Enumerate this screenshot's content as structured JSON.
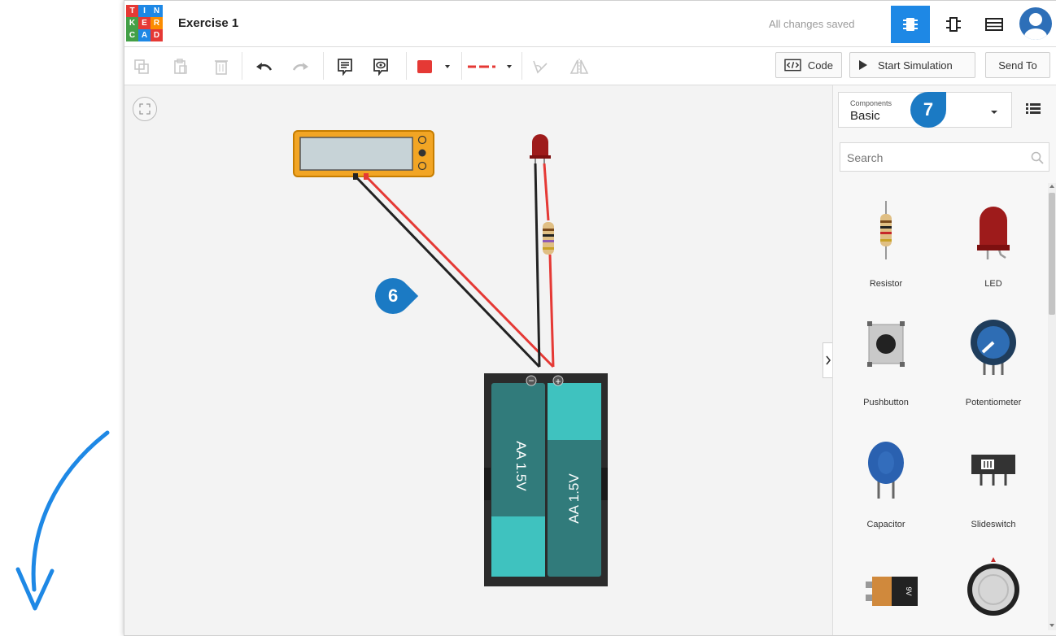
{
  "app": {
    "logo_letters": [
      "T",
      "I",
      "N",
      "K",
      "E",
      "R",
      "C",
      "A",
      "D"
    ],
    "logo_colors": [
      "#e53935",
      "#1e88e5",
      "#1e88e5",
      "#43a047",
      "#e53935",
      "#fb8c00",
      "#43a047",
      "#1e88e5",
      "#e53935"
    ],
    "title": "Exercise 1",
    "status": "All changes saved"
  },
  "toolbar": {
    "code_label": "Code",
    "start_simulation_label": "Start Simulation",
    "send_to_label": "Send To",
    "fill_color": "#e53935",
    "wire_color": "#e53935"
  },
  "panel": {
    "category_caption": "Components",
    "category_value": "Basic",
    "search_placeholder": "Search",
    "components": [
      {
        "name": "Resistor",
        "icon": "resistor-icon"
      },
      {
        "name": "LED",
        "icon": "led-icon"
      },
      {
        "name": "Pushbutton",
        "icon": "pushbutton-icon"
      },
      {
        "name": "Potentiometer",
        "icon": "potentiometer-icon"
      },
      {
        "name": "Capacitor",
        "icon": "capacitor-icon"
      },
      {
        "name": "Slideswitch",
        "icon": "slideswitch-icon"
      },
      {
        "name": "",
        "icon": "battery-9v-icon"
      },
      {
        "name": "",
        "icon": "coin-cell-icon"
      }
    ]
  },
  "canvas": {
    "battery_label_1": "AA 1.5V",
    "battery_label_2": "AA 1.5V",
    "battery_9v_label": "9V",
    "minus_sign": "−",
    "plus_sign": "+"
  },
  "callouts": {
    "six": "6",
    "seven": "7"
  },
  "colors": {
    "accent": "#1e88e5",
    "callout": "#1b7ac4"
  }
}
